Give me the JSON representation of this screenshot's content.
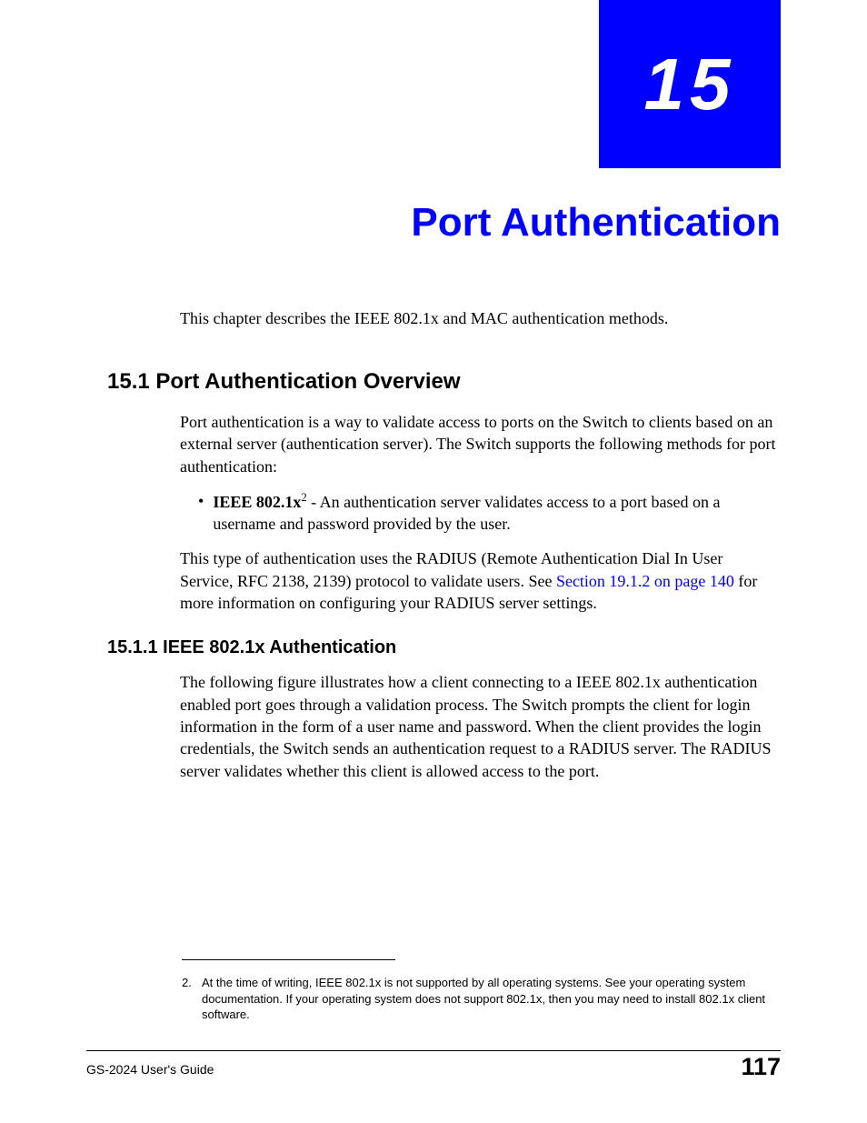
{
  "chapter": {
    "number": "15",
    "title": "Port Authentication"
  },
  "intro": "This chapter describes the IEEE 802.1x and MAC authentication methods.",
  "section1": {
    "heading": "15.1  Port Authentication Overview",
    "p1": "Port authentication is a way to validate access to ports on the Switch to clients based on an external server (authentication server). The Switch supports the following methods for port authentication:",
    "bullet_dot": "•",
    "bullet_bold": "IEEE 802.1x",
    "bullet_sup": "2",
    "bullet_rest": " - An authentication server validates access to a port based on a username and password provided by the user.",
    "p2_a": "This type of authentication uses the RADIUS (Remote Authentication Dial In User Service, RFC 2138, 2139) protocol to validate users. See ",
    "p2_link": "Section 19.1.2 on page 140",
    "p2_b": " for more information on configuring your RADIUS server settings."
  },
  "section11": {
    "heading": "15.1.1  IEEE 802.1x Authentication",
    "p1": "The following figure illustrates how a client connecting to a IEEE 802.1x authentication enabled port goes through a validation process. The Switch prompts the client for login information in the form of a user name and password. When the client provides the login credentials, the Switch sends an authentication request to a RADIUS server. The RADIUS server validates whether this client is allowed access to the port."
  },
  "footnote": {
    "num": "2.",
    "text": "At the time of writing, IEEE 802.1x is not supported by all operating systems. See your operating system documentation. If your operating system does not support 802.1x, then you may need to install 802.1x client software."
  },
  "footer": {
    "left": "GS-2024 User's Guide",
    "page": "117"
  }
}
